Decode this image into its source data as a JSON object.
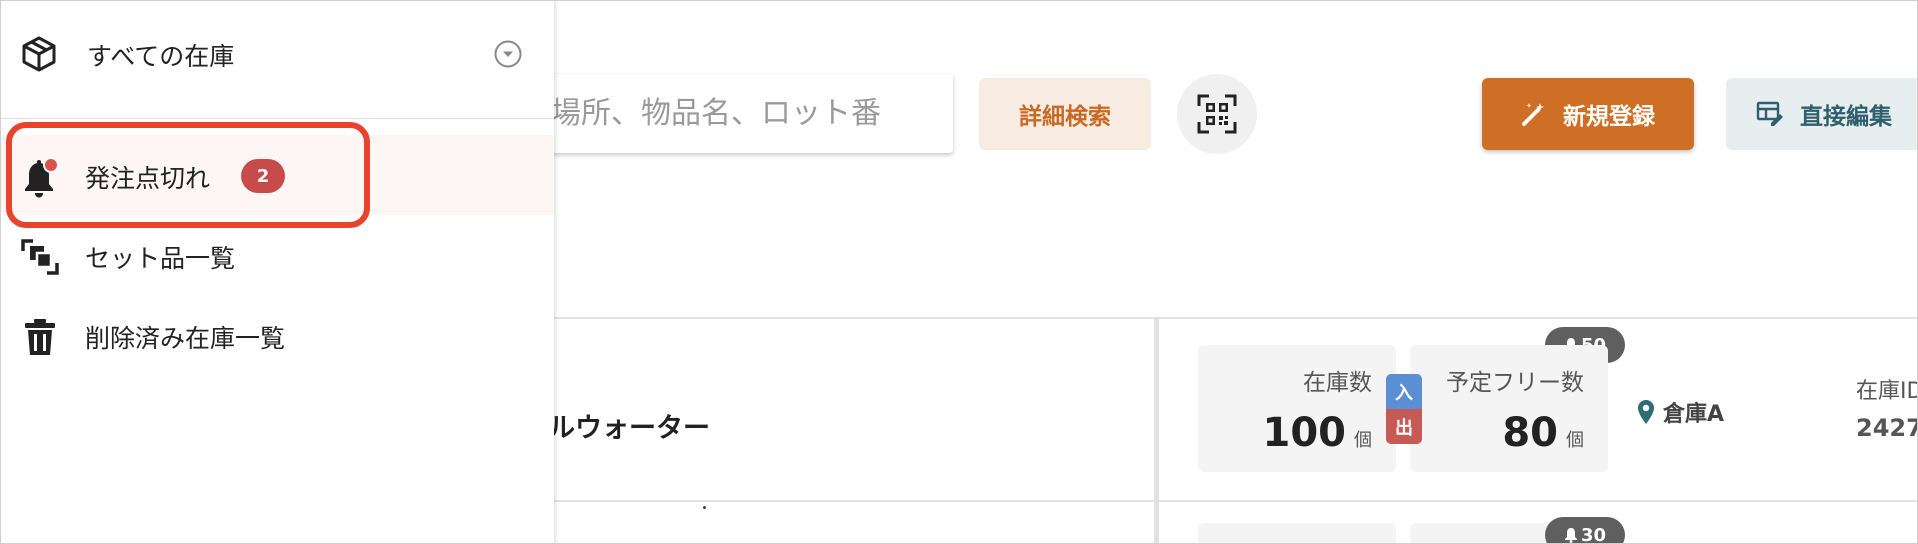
{
  "drawer": {
    "header_title": "すべての在庫",
    "items": [
      {
        "label": "発注点切れ",
        "badge": "2"
      },
      {
        "label": "セット品一覧"
      },
      {
        "label": "削除済み在庫一覧"
      }
    ]
  },
  "toolbar": {
    "search_placeholder": "管場所、物品名、ロット番",
    "advanced_search_label": "詳細検索",
    "new_register_label": "新規登録",
    "direct_edit_label": "直接編集"
  },
  "row1": {
    "product_name": "ラルウォーター",
    "threshold_badge": "50",
    "stock_label": "在庫数",
    "stock_value": "100",
    "stock_unit": "個",
    "in_label": "入",
    "out_label": "出",
    "free_label": "予定フリー数",
    "free_value": "80",
    "free_unit": "個",
    "location": "倉庫A",
    "id_label": "在庫ID",
    "id_value": "2427"
  },
  "row2": {
    "threshold_badge": "30"
  },
  "colors": {
    "accent_orange": "#cf6f26",
    "badge_red": "#c74b4b",
    "highlight_red": "#e8432d",
    "in_blue": "#5b8fd4",
    "out_red": "#c85a56"
  },
  "icons": {
    "header": "box-icon",
    "chevron": "chevron-down-circle-icon",
    "item1": "bell-icon",
    "item2": "set-icon",
    "item3": "trash-icon",
    "qr": "qr-code-icon",
    "new": "magic-wand-icon",
    "direct": "table-edit-icon",
    "location": "location-pin-icon"
  }
}
